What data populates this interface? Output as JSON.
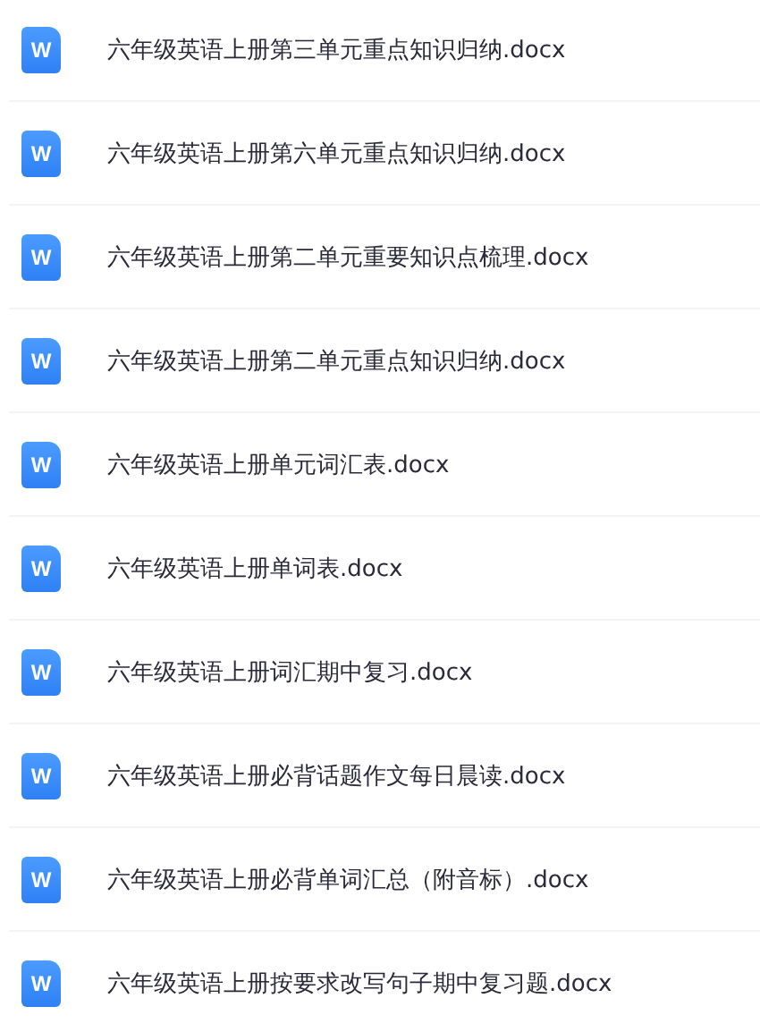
{
  "files": [
    {
      "icon": "W",
      "name": "六年级英语上册第三单元重点知识归纳.docx"
    },
    {
      "icon": "W",
      "name": "六年级英语上册第六单元重点知识归纳.docx"
    },
    {
      "icon": "W",
      "name": "六年级英语上册第二单元重要知识点梳理.docx"
    },
    {
      "icon": "W",
      "name": "六年级英语上册第二单元重点知识归纳.docx"
    },
    {
      "icon": "W",
      "name": "六年级英语上册单元词汇表.docx"
    },
    {
      "icon": "W",
      "name": "六年级英语上册单词表.docx"
    },
    {
      "icon": "W",
      "name": "六年级英语上册词汇期中复习.docx"
    },
    {
      "icon": "W",
      "name": "六年级英语上册必背话题作文每日晨读.docx"
    },
    {
      "icon": "W",
      "name": "六年级英语上册必背单词汇总（附音标）.docx"
    },
    {
      "icon": "W",
      "name": "六年级英语上册按要求改写句子期中复习题.docx"
    }
  ]
}
